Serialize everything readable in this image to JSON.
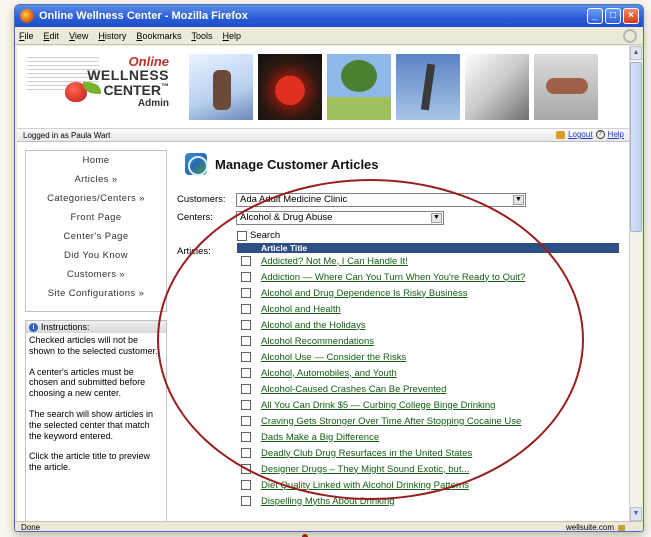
{
  "window": {
    "title": "Online Wellness Center - Mozilla Firefox"
  },
  "menu": [
    "File",
    "Edit",
    "View",
    "History",
    "Bookmarks",
    "Tools",
    "Help"
  ],
  "logo": {
    "line1": "Online",
    "line2": "WELLNESS",
    "line3": "CENTER",
    "tm": "™",
    "line4": "Admin"
  },
  "login": {
    "text": "Logged in as Paula Wart",
    "logout": "Logout",
    "help": "Help"
  },
  "sidebar": {
    "items": [
      "Home",
      "Articles »",
      "Categories/Centers »",
      "Front Page",
      "Center's Page",
      "Did You Know",
      "Customers »",
      "Site Configurations »"
    ]
  },
  "instructions": {
    "title": "Instructions:",
    "paragraphs": [
      "Checked articles will not be shown to the selected customer.",
      "A center's articles must be chosen and submitted before choosing a new center.",
      "The search will show articles in the selected center that match the keyword entered.",
      "Click the article title to preview the article."
    ]
  },
  "main": {
    "title": "Manage Customer Articles",
    "customers_label": "Customers:",
    "customers_value": "Ada Adult Medicine Clinic",
    "centers_label": "Centers:",
    "centers_value": "Alcohol & Drug Abuse",
    "search_label": "Search",
    "articles_label": "Articles:",
    "table_header": "Article Title",
    "articles": [
      "Addicted? Not Me, I Can Handle It!",
      "Addiction — Where Can You Turn When You're Ready to Quit?",
      "Alcohol and Drug Dependence Is Risky Business",
      "Alcohol and Health",
      "Alcohol and the Holidays",
      "Alcohol Recommendations",
      "Alcohol Use — Consider the Risks",
      "Alcohol, Automobiles, and Youth",
      "Alcohol-Caused Crashes Can Be Prevented",
      "All You Can Drink $5 — Curbing College Binge Drinking",
      "Craving Gets Stronger Over Time After Stopping Cocaine Use",
      "Dads Make a Big Difference",
      "Deadly Club Drug Resurfaces in the United States",
      "Designer Drugs – They Might Sound Exotic, but...",
      "Diet Quality Linked with Alcohol Drinking Patterns",
      "Dispelling Myths About Drinking"
    ]
  },
  "status": {
    "left": "Done",
    "right": "wellsuite.com"
  },
  "colors": {
    "accent": "#2d4f86",
    "link": "#146014",
    "annotation": "#9a1e1e",
    "titlebar": "#2a5bd6"
  }
}
